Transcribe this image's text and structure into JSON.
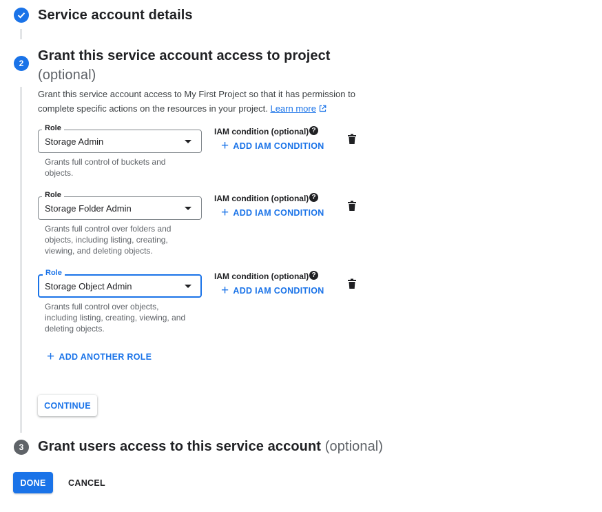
{
  "steps": {
    "step1": {
      "title": "Service account details"
    },
    "step2": {
      "number": "2",
      "title": "Grant this service account access to project",
      "optional": "(optional)",
      "description": "Grant this service account access to My First Project so that it has permission to complete specific actions on the resources in your project.",
      "learn_more": "Learn more"
    },
    "step3": {
      "number": "3",
      "title": "Grant users access to this service account",
      "optional": "(optional)"
    }
  },
  "roles": [
    {
      "label": "Role",
      "value": "Storage Admin",
      "hint": "Grants full control of buckets and objects.",
      "iam_label": "IAM condition (optional)",
      "add_iam": "ADD IAM CONDITION"
    },
    {
      "label": "Role",
      "value": "Storage Folder Admin",
      "hint": "Grants full control over folders and objects, including listing, creating, viewing, and deleting objects.",
      "iam_label": "IAM condition (optional)",
      "add_iam": "ADD IAM CONDITION"
    },
    {
      "label": "Role",
      "value": "Storage Object Admin",
      "hint": "Grants full control over objects, including listing, creating, viewing, and deleting objects.",
      "iam_label": "IAM condition (optional)",
      "add_iam": "ADD IAM CONDITION"
    }
  ],
  "actions": {
    "add_another_role": "ADD ANOTHER ROLE",
    "continue": "CONTINUE",
    "done": "DONE",
    "cancel": "CANCEL"
  },
  "colors": {
    "accent": "#1a73e8",
    "muted": "#5f6368",
    "text": "#202124"
  },
  "icons": {
    "check": "check-icon",
    "help": "help-icon",
    "delete": "trash-icon",
    "plus": "plus-icon",
    "external": "external-link-icon"
  }
}
